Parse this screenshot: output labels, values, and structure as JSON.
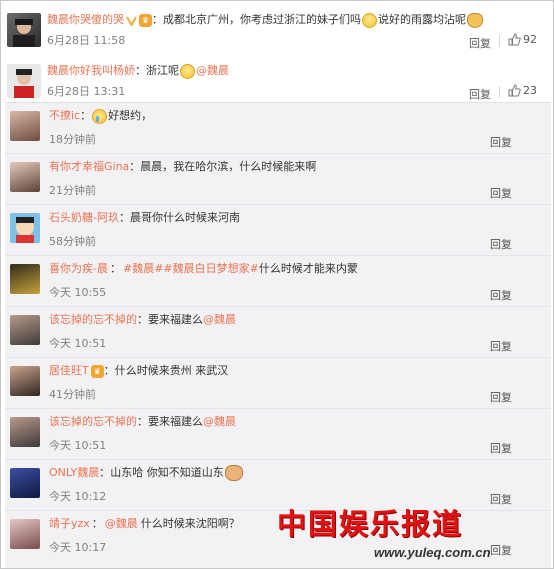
{
  "top_comments": [
    {
      "username": "魏晨你哭傻的哭",
      "segments": [
        {
          "type": "text",
          "value": "：成都北京广州，你考虑过浙江的妹子们吗"
        },
        {
          "type": "emoji",
          "name": "laugh-emoji"
        },
        {
          "type": "text",
          "value": "说好的雨露均沾呢"
        },
        {
          "type": "emoji",
          "name": "cat-emoji"
        }
      ],
      "time": "6月28日 11:58",
      "reply_label": "回复",
      "likes": "92"
    },
    {
      "username": "魏晨你好我叫杨娇",
      "segments": [
        {
          "type": "text",
          "value": "：浙江呢"
        },
        {
          "type": "emoji",
          "name": "laugh-emoji"
        },
        {
          "type": "mention",
          "value": "@魏晨"
        }
      ],
      "time": "6月28日 13:31",
      "reply_label": "回复",
      "likes": "23"
    }
  ],
  "replies": [
    {
      "username": "不撩ic",
      "text": "：",
      "emoji": "cry-emoji",
      "text_after": "好想约，",
      "mention": "",
      "time": "18分钟前",
      "reply_label": "回复"
    },
    {
      "username": "有你才幸福Gina",
      "text": "：晨晨，我在哈尔滨，什么时候能来啊",
      "mention": "",
      "time": "21分钟前",
      "reply_label": "回复"
    },
    {
      "username": "石头奶糖-阿玖",
      "text": "：晨哥你什么时候来河南",
      "mention": "",
      "time": "58分钟前",
      "reply_label": "回复"
    },
    {
      "username": "喜你为疾-晨",
      "mention_first": "#魏晨##魏晨白日梦想家#",
      "text": "什么时候才能来内蒙",
      "time": "今天 10:55",
      "reply_label": "回复"
    },
    {
      "username": "该忘掉的忘不掉的",
      "text": "：要来福建么",
      "mention": "@魏晨",
      "time": "今天 10:51",
      "reply_label": "回复"
    },
    {
      "username": "居佳旺T",
      "text": "：什么时候来贵州 来武汉",
      "mention": "",
      "time": "41分钟前",
      "reply_label": "回复"
    },
    {
      "username": "该忘掉的忘不掉的",
      "text": "：要来福建么",
      "mention": "@魏晨",
      "time": "今天 10:51",
      "reply_label": "回复"
    },
    {
      "username": "ONLY魏晨",
      "text": "：山东哈 你知不知道山东",
      "emoji": "dog-emoji",
      "mention": "",
      "time": "今天 10:12",
      "reply_label": "回复"
    },
    {
      "username": "靖子yzx",
      "mention_first": "@魏晨",
      "text": "什么时候来沈阳啊？",
      "time": "今天 10:17",
      "reply_label": "回复"
    }
  ],
  "watermark": {
    "title": "中国娱乐报道",
    "url": "www.yuleq.com.cn"
  },
  "colors": {
    "username": "#eb7350",
    "reply_bg": "#f2f2f5",
    "watermark_red": "#e21212"
  }
}
